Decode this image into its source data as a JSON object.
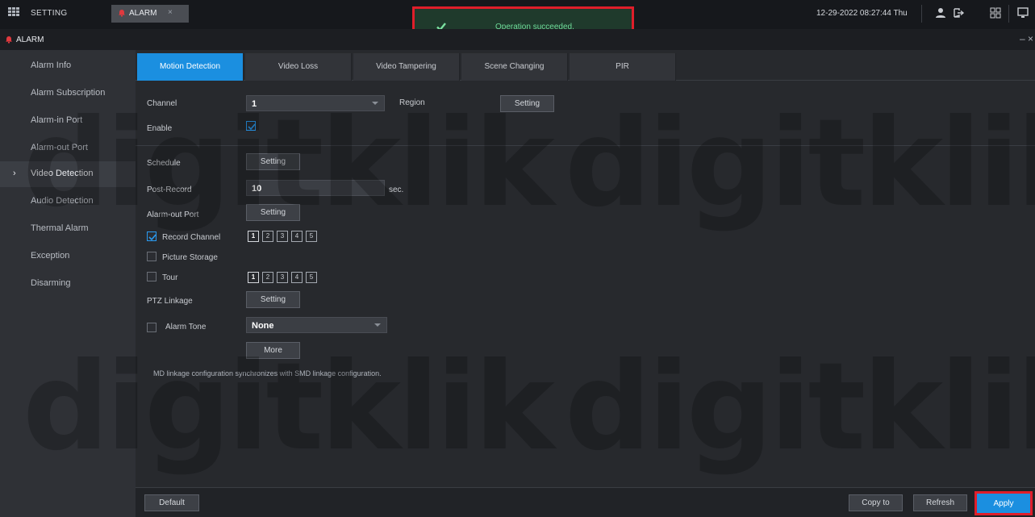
{
  "topbar": {
    "setting_label": "SETTING",
    "alarm_tab_label": "ALARM",
    "close_symbol": "×",
    "datetime": "12-29-2022 08:27:44 Thu"
  },
  "toast": {
    "message": "Operation succeeded.",
    "color": "#6fdc9a",
    "border_color": "#e01e2a"
  },
  "titlebar": {
    "title": "ALARM",
    "window_controls": "– ×"
  },
  "sidebar": {
    "items": [
      {
        "label": "Alarm Info"
      },
      {
        "label": "Alarm Subscription"
      },
      {
        "label": "Alarm-in Port"
      },
      {
        "label": "Alarm-out Port"
      },
      {
        "label": "Video Detection",
        "active": true,
        "chevron": "›"
      },
      {
        "label": "Audio Detection"
      },
      {
        "label": "Thermal Alarm"
      },
      {
        "label": "Exception"
      },
      {
        "label": "Disarming"
      }
    ]
  },
  "tabs": [
    {
      "label": "Motion Detection",
      "active": true
    },
    {
      "label": "Video Loss"
    },
    {
      "label": "Video Tampering"
    },
    {
      "label": "Scene Changing"
    },
    {
      "label": "PIR"
    }
  ],
  "form": {
    "channel_label": "Channel",
    "channel_value": "1",
    "region_label": "Region",
    "region_button": "Setting",
    "enable_label": "Enable",
    "schedule_label": "Schedule",
    "schedule_button": "Setting",
    "post_record_label": "Post-Record",
    "post_record_value": "10",
    "post_record_unit": "sec.",
    "alarm_out_label": "Alarm-out Port",
    "alarm_out_button": "Setting",
    "record_channel_label": "Record Channel",
    "record_channels": [
      "1",
      "2",
      "3",
      "4",
      "5"
    ],
    "picture_storage_label": "Picture Storage",
    "tour_label": "Tour",
    "tour_channels": [
      "1",
      "2",
      "3",
      "4",
      "5"
    ],
    "ptz_label": "PTZ Linkage",
    "ptz_button": "Setting",
    "alarm_tone_label": "Alarm Tone",
    "alarm_tone_value": "None",
    "more_button": "More",
    "note": "MD linkage configuration synchronizes with SMD linkage configuration."
  },
  "footer": {
    "default_button": "Default",
    "copy_button": "Copy to",
    "refresh_button": "Refresh",
    "apply_button": "Apply"
  },
  "watermark": {
    "text": "digitklik"
  },
  "colors": {
    "accent": "#1b8fe0",
    "highlight": "#e01e2a",
    "alarm": "#e0393e"
  }
}
